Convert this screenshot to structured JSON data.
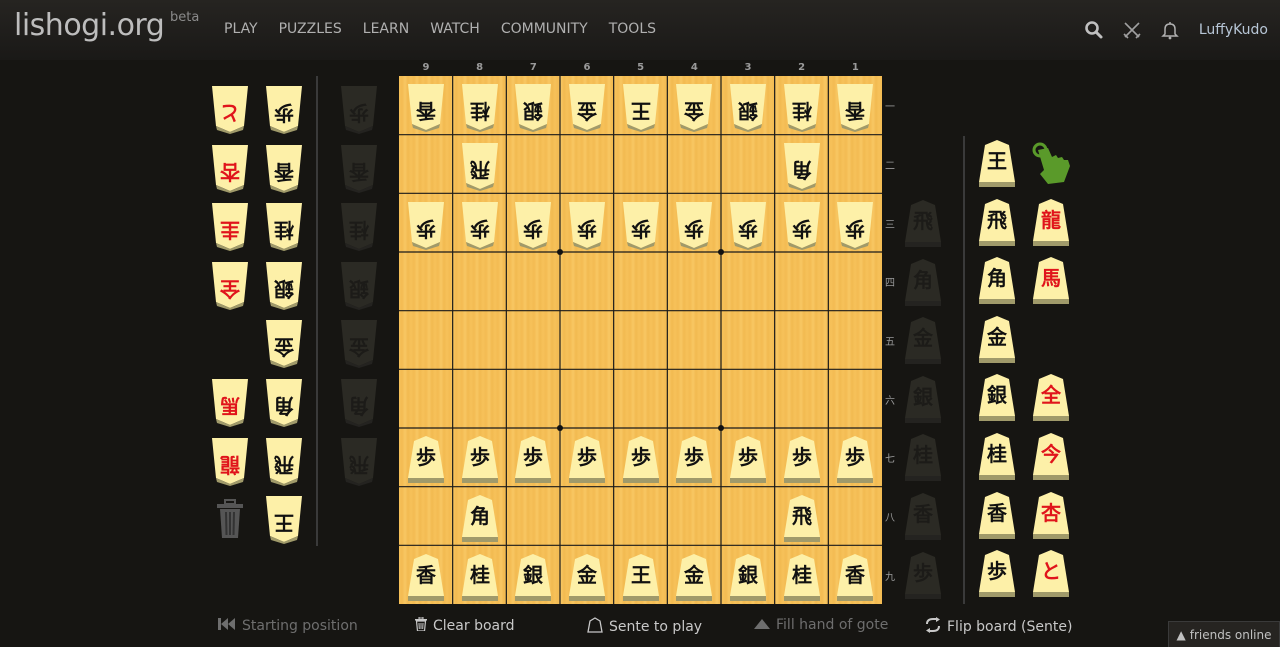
{
  "header": {
    "logo": "lishogi.org",
    "beta": "beta",
    "nav": [
      "PLAY",
      "PUZZLES",
      "LEARN",
      "WATCH",
      "COMMUNITY",
      "TOOLS"
    ],
    "icons": [
      "search-icon",
      "crossed-swords-icon",
      "bell-icon"
    ],
    "username": "LuffyKudo"
  },
  "board": {
    "files": [
      "9",
      "8",
      "7",
      "6",
      "5",
      "4",
      "3",
      "2",
      "1"
    ],
    "ranks": [
      "一",
      "二",
      "三",
      "四",
      "五",
      "六",
      "七",
      "八",
      "九"
    ],
    "position": [
      [
        "g:香",
        "g:桂",
        "g:銀",
        "g:金",
        "g:王",
        "g:金",
        "g:銀",
        "g:桂",
        "g:香"
      ],
      [
        "",
        "g:飛",
        "",
        "",
        "",
        "",
        "",
        "g:角",
        ""
      ],
      [
        "g:歩",
        "g:歩",
        "g:歩",
        "g:歩",
        "g:歩",
        "g:歩",
        "g:歩",
        "g:歩",
        "g:歩"
      ],
      [
        "",
        "",
        "",
        "",
        "",
        "",
        "",
        "",
        ""
      ],
      [
        "",
        "",
        "",
        "",
        "",
        "",
        "",
        "",
        ""
      ],
      [
        "",
        "",
        "",
        "",
        "",
        "",
        "",
        "",
        ""
      ],
      [
        "s:歩",
        "s:歩",
        "s:歩",
        "s:歩",
        "s:歩",
        "s:歩",
        "s:歩",
        "s:歩",
        "s:歩"
      ],
      [
        "",
        "s:角",
        "",
        "",
        "",
        "",
        "",
        "s:飛",
        ""
      ],
      [
        "s:香",
        "s:桂",
        "s:銀",
        "s:金",
        "s:王",
        "s:金",
        "s:銀",
        "s:桂",
        "s:香"
      ]
    ]
  },
  "gote_spare": {
    "promoted": [
      "と",
      "杏",
      "圭",
      "全",
      "",
      "馬",
      "龍"
    ],
    "normal": [
      "歩",
      "香",
      "桂",
      "銀",
      "金",
      "角",
      "飛",
      "王"
    ],
    "hand": [
      "歩",
      "香",
      "桂",
      "銀",
      "金",
      "角",
      "飛"
    ],
    "trash_icon": "trash-icon"
  },
  "sente_spare": {
    "normal": [
      "王",
      "飛",
      "角",
      "金",
      "銀",
      "桂",
      "香",
      "歩"
    ],
    "promoted": [
      "",
      "龍",
      "馬",
      "",
      "全",
      "今",
      "杏",
      "と"
    ],
    "hand": [
      "飛",
      "角",
      "金",
      "銀",
      "桂",
      "香",
      "歩"
    ],
    "pointer_icon": "hand-pointer-icon"
  },
  "controls": {
    "starting_position": "Starting position",
    "clear_board": "Clear board",
    "sente_to_play": "Sente to play",
    "fill_hand": "Fill hand of gote",
    "flip_board": "Flip board (Sente)"
  },
  "friends": "friends online",
  "colors": {
    "board": "#f6c15a",
    "piece_face": "#fdf0a8",
    "promoted_text": "#e0141b",
    "pointer_green": "#5a9a2a"
  }
}
